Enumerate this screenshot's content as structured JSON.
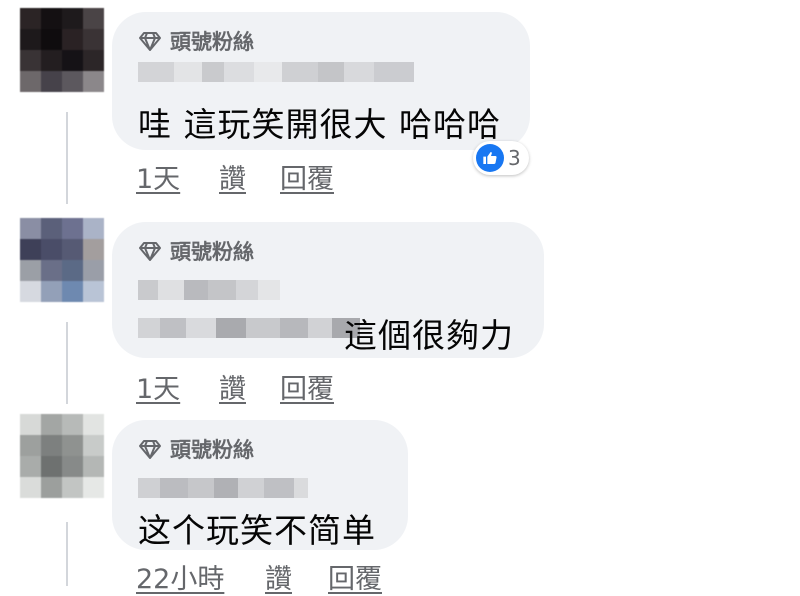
{
  "comments": [
    {
      "badge_label": "頭號粉絲",
      "badge_icon": "diamond-icon",
      "text": "哇 這玩笑開很大 哈哈哈",
      "time": "1天",
      "like_label": "讚",
      "reply_label": "回覆",
      "reaction_icon": "like-icon",
      "reaction_count": "3"
    },
    {
      "badge_label": "頭號粉絲",
      "badge_icon": "diamond-icon",
      "text": "這個很夠力",
      "time": "1天",
      "like_label": "讚",
      "reply_label": "回覆"
    },
    {
      "badge_label": "頭號粉絲",
      "badge_icon": "diamond-icon",
      "text": "这个玩笑不简单",
      "time": "22小時",
      "like_label": "讚",
      "reply_label": "回覆"
    }
  ],
  "colors": {
    "bubble": "#f0f2f5",
    "meta_text": "#65676b",
    "like_blue": "#1877f2"
  }
}
